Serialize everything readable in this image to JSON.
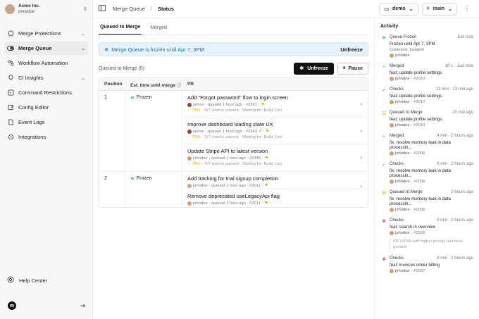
{
  "sidebar": {
    "org_name": "Acme Inc.",
    "user_name": "drewdoe",
    "items": [
      {
        "label": "Merge Protections",
        "icon": "shield-icon",
        "chevron": true
      },
      {
        "label": "Merge Queue",
        "icon": "toggle-icon",
        "chevron": true,
        "active": true
      },
      {
        "label": "Workflow Automation",
        "icon": "workflow-icon"
      },
      {
        "label": "CI Insights",
        "icon": "lightbulb-icon",
        "chevron": true
      },
      {
        "label": "Command Restrictions",
        "icon": "command-icon"
      },
      {
        "label": "Config Editor",
        "icon": "edit-icon"
      },
      {
        "label": "Event Logs",
        "icon": "file-icon"
      },
      {
        "label": "Integrations",
        "icon": "plug-icon"
      }
    ],
    "help": "Help Center",
    "logo_letter": "m"
  },
  "topbar": {
    "crumb_parent": "Merge Queue",
    "crumb_current": "Status",
    "repo": "demo",
    "branch": "main"
  },
  "tabs": [
    "Queued to Merge",
    "Merged"
  ],
  "banner": {
    "text": "Merge Queue is frozen until Apr 7, 3PM",
    "action": "Unfreeze"
  },
  "queue": {
    "title": "Queued to Merge (5)",
    "unfreeze_label": "Unfreeze",
    "pause_label": "Pause"
  },
  "table": {
    "headers": {
      "position": "Position",
      "est": "Est. time until merge",
      "pr": "PR"
    },
    "groups": [
      {
        "position": "1",
        "status": "Frozen",
        "prs": [
          {
            "title": "Add \"Forgot password\" flow to login screen",
            "user": "james",
            "meta": "· queued 1 hour ago · #2341 ·",
            "pct": "75%",
            "checks": "· 5/7 checks passed · Waiting for: Build, Lint"
          },
          {
            "title": "Improve dashboard loading state UX",
            "user": "james",
            "meta": "· queued 1 hour ago · #2343 ↗ ·",
            "pct": "75%",
            "checks": "· 5/7 checks passed · Waiting for: Build, Lint"
          },
          {
            "title": "Update Stripe API to latest version",
            "user": "johndoe",
            "meta": "· queued 1 hour ago · #2345 ·",
            "pct": "75%",
            "checks": "· 5/7 checks passed · Waiting for: Build, Lint"
          }
        ]
      },
      {
        "position": "2",
        "status": "Frozen",
        "prs": [
          {
            "title": "Add tracking for trial signup completion",
            "user": "johndoe",
            "meta": "· queued 1 hour ago · #2011 ·"
          },
          {
            "title": "Remove deprecated useLegacyApi flag",
            "user": "johndoe",
            "meta": "· queued 1 hour ago · #2011 ·"
          }
        ]
      }
    ]
  },
  "activity": {
    "title": "Activity",
    "events": [
      {
        "icon": "snowflake-icon",
        "color": "#3b9ad9",
        "label": "Queue Frozen",
        "time": "Just now",
        "line2": "Frozen until Apr 7, 3PM",
        "line3": "Comment: Incident",
        "user": "johndoe"
      },
      {
        "icon": "merge-icon",
        "color": "#2da44e",
        "label": "Merged",
        "time": "10 s · Just now",
        "line2": "feat: update profile settings",
        "user": "johndoe",
        "hash": "· #2010"
      },
      {
        "icon": "check-circle-icon",
        "color": "#2da44e",
        "label": "Checks",
        "time": "13 min · 13 min ago",
        "line2": "feat: update profile settings",
        "user": "johndoe",
        "hash": "· #2010"
      },
      {
        "icon": "queue-icon",
        "color": "#e2a400",
        "label": "Queued to Merge",
        "time": "20 min ago",
        "line2": "feat: update profile settings",
        "user": "johndoe",
        "hash": "· #2010"
      },
      {
        "icon": "merge-icon",
        "color": "#2da44e",
        "label": "Merged",
        "time": "4 min · 2 hours ago",
        "line2": "fix: resolve memory leak in data processin...",
        "user": "johndoe",
        "hash": "· #2009"
      },
      {
        "icon": "check-circle-icon",
        "color": "#2da44e",
        "label": "Checks",
        "time": "8 min · 2 hours ago",
        "line2": "fix: resolve memory leak in data processin...",
        "user": "johndoe",
        "hash": "· #2009"
      },
      {
        "icon": "queue-icon",
        "color": "#e2a400",
        "label": "Queued to Merge",
        "time": "2 hours ago",
        "line2": "fix: resolve memory leak in data processin...",
        "user": "johndoe",
        "hash": "· #2009"
      },
      {
        "icon": "x-circle-icon",
        "color": "#d1242f",
        "label": "Checks",
        "time": "8 min · 2 hours ago",
        "line2": "feat: search in overview",
        "user": "johndoe",
        "hash": "· #2008",
        "note": "PR #2009 with higher priority has been queued"
      },
      {
        "icon": "x-circle-icon",
        "color": "#d1242f",
        "label": "Checks",
        "time": "8 min · 2 hours ago",
        "line2": "feat: invoices under billing",
        "user": "johndoe",
        "hash": "· #2007"
      }
    ]
  }
}
